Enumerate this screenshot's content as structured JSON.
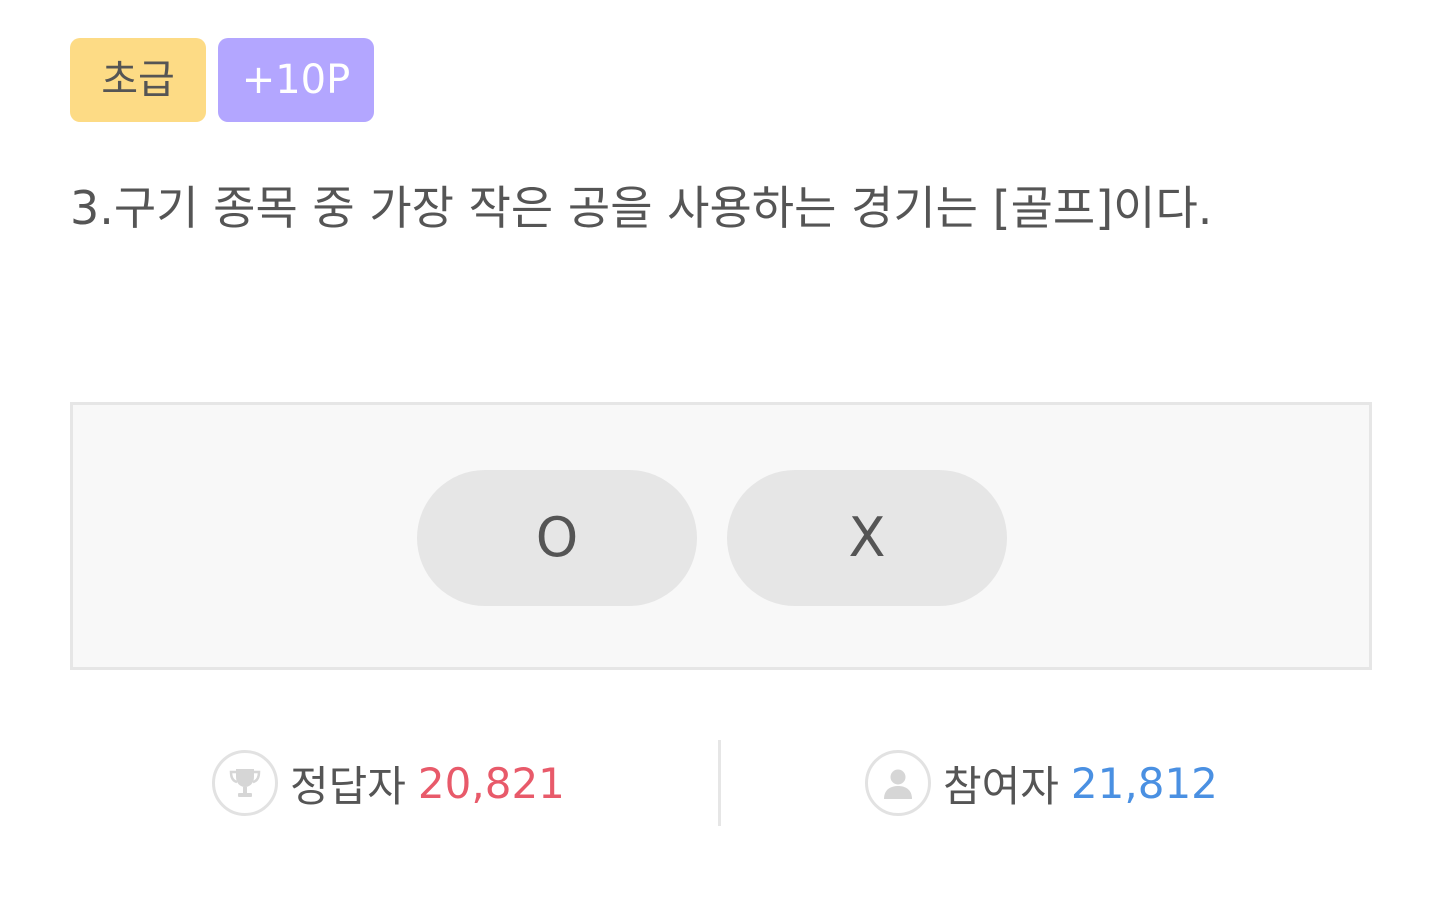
{
  "badges": {
    "level": "초급",
    "points": "+10P"
  },
  "question": {
    "text": "3.구기 종목 중 가장 작은 공을 사용하는 경기는 [골프]이다."
  },
  "answers": {
    "o_label": "O",
    "x_label": "X"
  },
  "stats": {
    "correct": {
      "icon": "trophy-icon",
      "label": "정답자",
      "value": "20,821",
      "color": "#e85a6a"
    },
    "participants": {
      "icon": "person-icon",
      "label": "참여자",
      "value": "21,812",
      "color": "#4a90e2"
    }
  },
  "colors": {
    "level_badge": "#fddb85",
    "points_badge": "#b3a6ff",
    "button_bg": "#e6e6e6",
    "panel_bg": "#f8f8f8"
  }
}
